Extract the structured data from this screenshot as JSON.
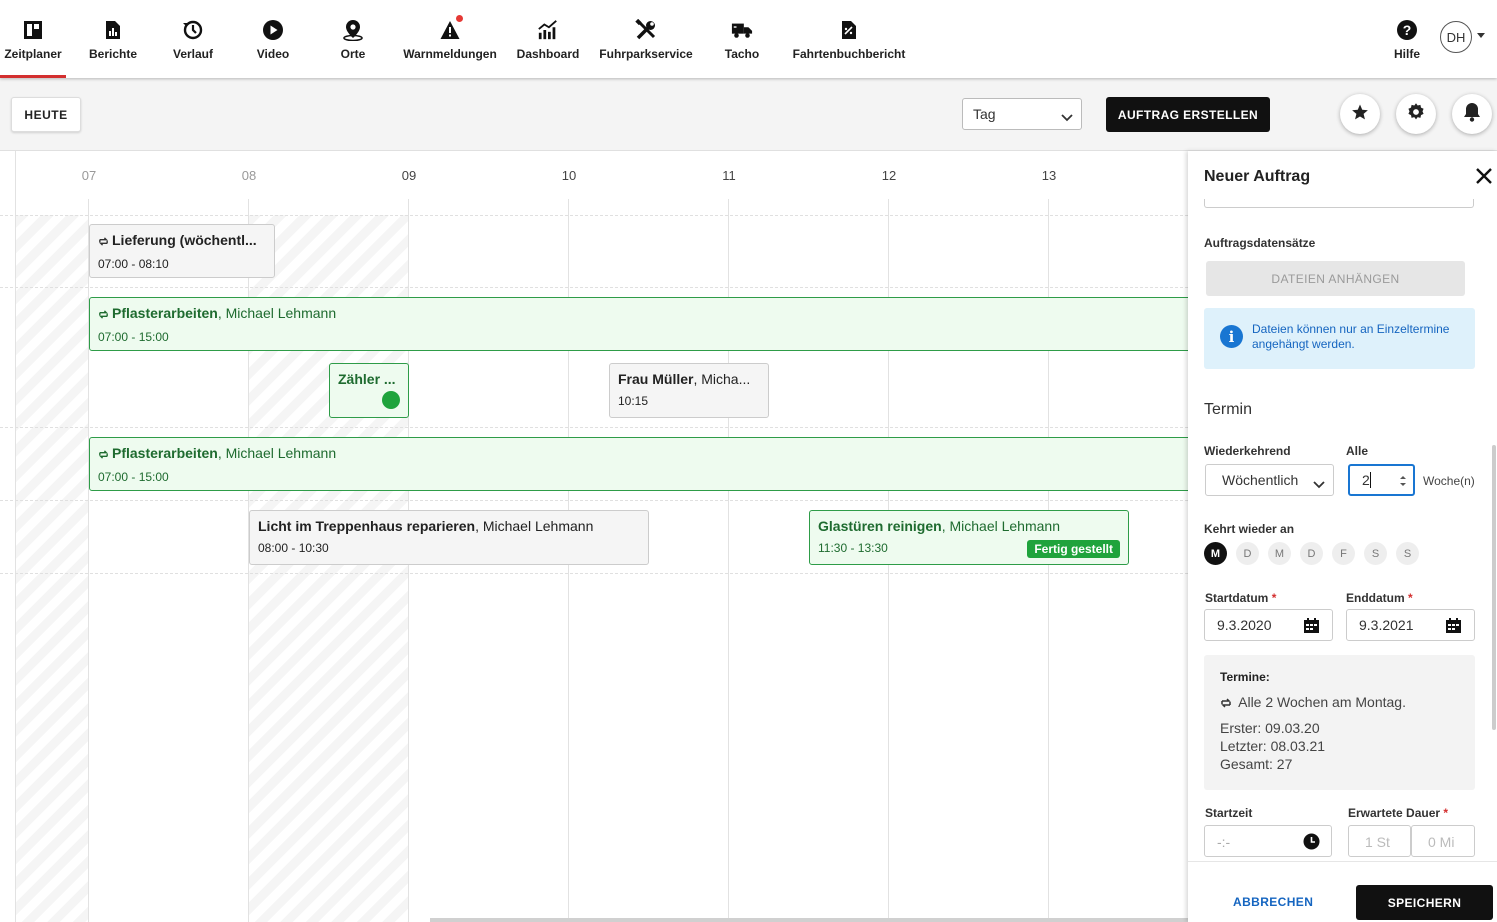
{
  "nav": {
    "items": [
      {
        "label": "Zeitplaner",
        "icon": "calendar-grid-icon"
      },
      {
        "label": "Berichte",
        "icon": "report-icon"
      },
      {
        "label": "Verlauf",
        "icon": "history-icon"
      },
      {
        "label": "Video",
        "icon": "play-icon"
      },
      {
        "label": "Orte",
        "icon": "location-pin-icon"
      },
      {
        "label": "Warnmeldungen",
        "icon": "warning-icon"
      },
      {
        "label": "Dashboard",
        "icon": "chart-icon"
      },
      {
        "label": "Fuhrparkservice",
        "icon": "wrench-icon"
      },
      {
        "label": "Tacho",
        "icon": "truck-icon"
      },
      {
        "label": "Fahrtenbuchbericht",
        "icon": "document-icon"
      }
    ],
    "help_label": "Hilfe",
    "avatar_initials": "DH",
    "active": "Zeitplaner",
    "accent_color": "#d32f2f"
  },
  "toolbar": {
    "today_label": "HEUTE",
    "view_select": "Tag",
    "create_label": "AUFTRAG ERSTELLEN"
  },
  "calendar": {
    "hours": [
      "07",
      "08",
      "09",
      "10",
      "11",
      "12",
      "13"
    ],
    "events": [
      {
        "title": "Lieferung (wöchentl...",
        "person": "",
        "time": "07:00 - 08:10",
        "recurring": true
      },
      {
        "title": "Pflasterarbeiten",
        "person": ", Michael Lehmann",
        "time": "07:00 - 15:00",
        "recurring": true
      },
      {
        "title": "Zähler ...",
        "person": "",
        "time": "",
        "recurring": false
      },
      {
        "title": "Frau Müller",
        "person": ", Micha...",
        "time": "10:15",
        "recurring": false
      },
      {
        "title": "Pflasterarbeiten",
        "person": ", Michael Lehmann",
        "time": "07:00 - 15:00",
        "recurring": true
      },
      {
        "title": "Licht im Treppenhaus reparieren",
        "person": ", Michael Lehmann",
        "time": "08:00 - 10:30",
        "recurring": false
      },
      {
        "title": "Glastüren reinigen",
        "person": ", Michael Lehmann",
        "time": "11:30 - 13:30",
        "recurring": false,
        "badge": "Fertig gestellt"
      }
    ],
    "status_color": "#1fa33c"
  },
  "panel": {
    "title": "Neuer Auftrag",
    "records_label": "Auftragsdatensätze",
    "attach_label": "DATEIEN ANHÄNGEN",
    "info_text": "Dateien können nur an Einzeltermine angehängt werden.",
    "section_title": "Termin",
    "recurring_label": "Wiederkehrend",
    "recurring_value": "Wöchentlich",
    "every_label": "Alle",
    "every_value": "2",
    "every_unit": "Woche(n)",
    "repeat_on_label": "Kehrt wieder an",
    "days": [
      "M",
      "D",
      "M",
      "D",
      "F",
      "S",
      "S"
    ],
    "start_date_label": "Startdatum",
    "start_date": "9.3.2020",
    "end_date_label": "Enddatum",
    "end_date": "9.3.2021",
    "required_mark": "*",
    "summary": {
      "heading": "Termine:",
      "rule": "Alle 2 Wochen am Montag.",
      "first": "Erster: 09.03.20",
      "last": "Letzter: 08.03.21",
      "total": "Gesamt: 27"
    },
    "start_time_label": "Startzeit",
    "start_time_placeholder": "-:-",
    "duration_label": "Erwartete Dauer",
    "duration_hours_placeholder": "1 St",
    "duration_minutes_placeholder": "0 Mi",
    "cancel_label": "ABBRECHEN",
    "save_label": "SPEICHERN"
  }
}
